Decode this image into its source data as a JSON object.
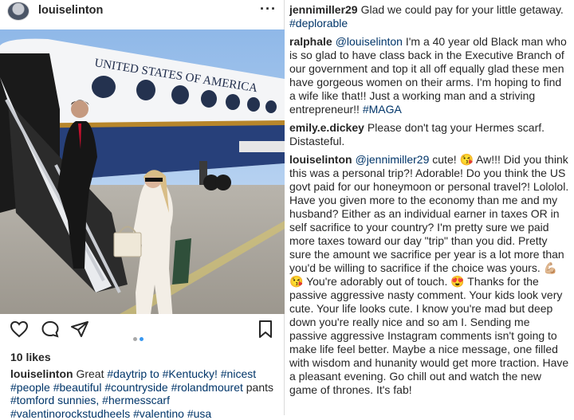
{
  "post": {
    "username": "louiselinton",
    "more_label": "···",
    "likes": "10 likes",
    "photo": {
      "plane_text": "UNITED STATES OF AMERICA"
    },
    "caption": {
      "user": "louiselinton",
      "text": "Great",
      "tags": "#daytrip to #Kentucky! #nicest #people #beautiful #countryside #rolandmouret",
      "text2": "pants",
      "tags2": "#tomford sunnies, #hermesscarf #valentinorockstudheels #valentino #usa"
    }
  },
  "comments": [
    {
      "user": "jennimiller29",
      "text": "Glad we could pay for your little getaway.",
      "tags": "#deplorable"
    },
    {
      "user": "ralphale",
      "mention": "@louiselinton",
      "text": "I'm a 40 year old Black man who is so glad to have class back in the Executive Branch of our government and top it all off equally glad these men have gorgeous women on their arms. I'm hoping to find a wife like that!! Just a working man and a striving entrepreneur!!",
      "tags": "#MAGA"
    },
    {
      "user": "emily.e.dickey",
      "text": "Please don't tag your Hermes scarf. Distasteful."
    },
    {
      "user": "louiselinton",
      "mention": "@jennimiller29",
      "text": "cute! 😘 Aw!!! Did you think this was a personal trip?! Adorable! Do you think the US govt paid for our honeymoon or personal travel?! Lololol. Have you given more to the economy than me and my husband? Either as an individual earner in taxes OR in self sacrifice to your country? I'm pretty sure we paid more taxes toward our day \"trip\" than you did. Pretty sure the amount we sacrifice per year is a lot more than you'd be willing to sacrifice if the choice was yours. 💪🏼😘 You're adorably out of touch. 😍 Thanks for the passive aggressive nasty comment. Your kids look very cute. Your life looks cute. I know you're mad but deep down you're really nice and so am I. Sending me passive aggressive Instagram comments isn't going to make life feel better. Maybe a nice message, one filled with wisdom and hunanity would get more traction. Have a pleasant evening. Go chill out and watch the new game of thrones. It's fab!"
    }
  ],
  "colors": {
    "link": "#003569",
    "text": "#262626",
    "carousel_active": "#3897f0",
    "carousel_inactive": "#a8a8a8"
  }
}
